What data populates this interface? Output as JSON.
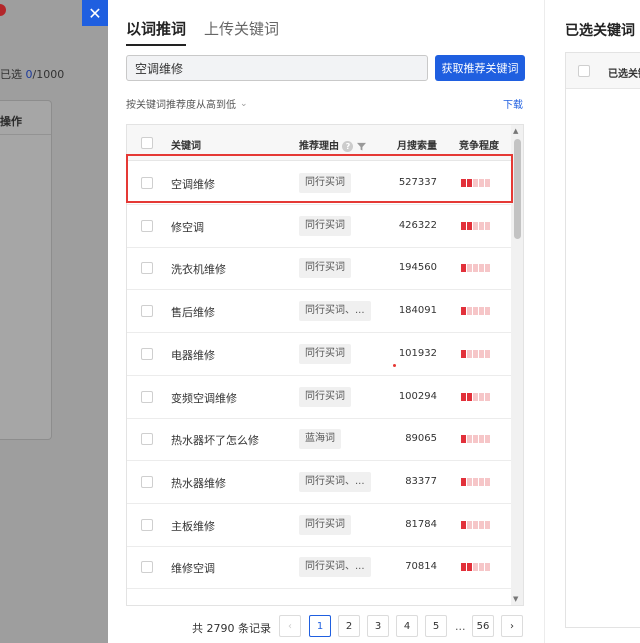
{
  "background": {
    "selected_prefix": "已选",
    "selected_count": "0",
    "selected_total": "/1000",
    "operation_label": "操作"
  },
  "close_label": "✕",
  "tabs": [
    {
      "label": "以词推词",
      "active": true
    },
    {
      "label": "上传关键词",
      "active": false
    }
  ],
  "search": {
    "value": "空调维修"
  },
  "fetch_button": "获取推荐关键词",
  "sort_label": "按关键词推荐度从高到低",
  "download_label": "下载",
  "columns": {
    "keyword": "关键词",
    "reason": "推荐理由",
    "volume": "月搜索量",
    "competition": "竞争程度"
  },
  "rows": [
    {
      "keyword": "空调维修",
      "reason": "同行买词",
      "volume": "527337",
      "competition": 2
    },
    {
      "keyword": "修空调",
      "reason": "同行买词",
      "volume": "426322",
      "competition": 2
    },
    {
      "keyword": "洗衣机维修",
      "reason": "同行买词",
      "volume": "194560",
      "competition": 1
    },
    {
      "keyword": "售后维修",
      "reason": "同行买词、...",
      "volume": "184091",
      "competition": 1
    },
    {
      "keyword": "电器维修",
      "reason": "同行买词",
      "volume": "101932",
      "competition": 1
    },
    {
      "keyword": "变频空调维修",
      "reason": "同行买词",
      "volume": "100294",
      "competition": 2
    },
    {
      "keyword": "热水器坏了怎么修",
      "reason": "蓝海词",
      "volume": "89065",
      "competition": 1
    },
    {
      "keyword": "热水器维修",
      "reason": "同行买词、...",
      "volume": "83377",
      "competition": 1
    },
    {
      "keyword": "主板维修",
      "reason": "同行买词",
      "volume": "81784",
      "competition": 1
    },
    {
      "keyword": "维修空调",
      "reason": "同行买词、...",
      "volume": "70814",
      "competition": 2
    }
  ],
  "pagination": {
    "total_text": "共 2790 条记录",
    "pages": [
      "1",
      "2",
      "3",
      "4",
      "5"
    ],
    "ellipsis": "...",
    "last_page": "56",
    "current": "1",
    "prev": "‹",
    "next": "›"
  },
  "right_panel": {
    "title": "已选关键词（",
    "column_label": "已选关键"
  },
  "colors": {
    "accent": "#1f5fe0",
    "highlight": "#e53935",
    "competition_on": "#e2303a",
    "competition_off": "#f6c6c8"
  }
}
